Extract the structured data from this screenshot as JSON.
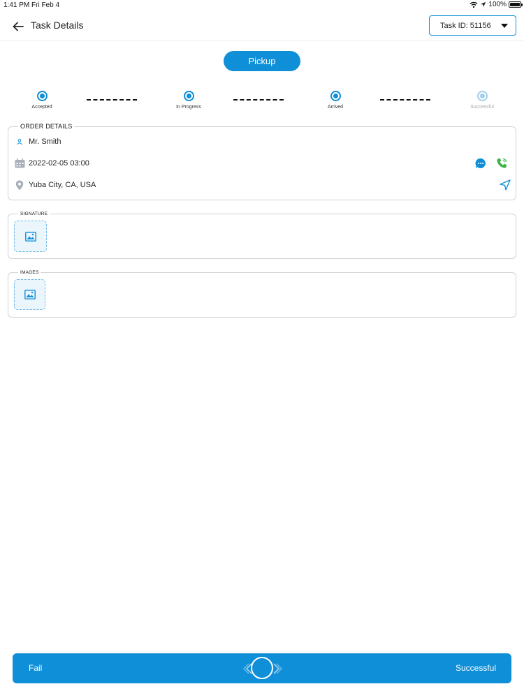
{
  "status_bar": {
    "time": "1:41 PM",
    "date": "Fri Feb 4",
    "battery": "100%"
  },
  "header": {
    "title": "Task Details",
    "task_id_label": "Task ID: 51156"
  },
  "action": {
    "pickup_label": "Pickup"
  },
  "steps": [
    {
      "label": "Accepted",
      "active": true
    },
    {
      "label": "In Progress",
      "active": true
    },
    {
      "label": "Arrived",
      "active": true
    },
    {
      "label": "Successful",
      "active": false
    }
  ],
  "order_details": {
    "title": "ORDER DETAILS",
    "customer": "Mr. Smith",
    "datetime": "2022-02-05 03:00",
    "location": "Yuba City, CA, USA"
  },
  "signature": {
    "title": "SIGNATURE"
  },
  "images": {
    "title": "IMAGES"
  },
  "slider": {
    "fail_label": "Fail",
    "success_label": "Successful"
  },
  "colors": {
    "accent": "#0e8fd8",
    "phone": "#3cb44a",
    "border": "#cfd3d8"
  }
}
